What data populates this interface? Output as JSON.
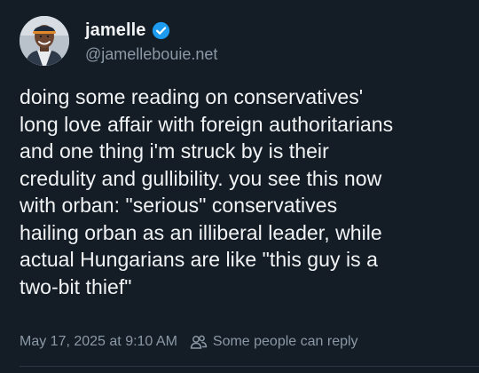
{
  "author": {
    "display_name": "jamelle",
    "handle": "@jamellebouie.net",
    "avatar_icon": "avatar-photo",
    "verified_icon": "verified-badge-icon",
    "verified_color": "#1d9bf0"
  },
  "post": {
    "text": "doing some reading on conservatives'\nlong love affair with foreign authoritarians\nand one thing i'm struck by is their\ncredulity and gullibility. you see this now\nwith orban: \"serious\" conservatives\nhailing orban as an illiberal leader, while\nactual Hungarians are like \"this guy is a\ntwo-bit thief\""
  },
  "meta": {
    "timestamp": "May 17, 2025 at 9:10 AM",
    "reply_setting": "Some people can reply",
    "reply_icon": "people-icon"
  },
  "colors": {
    "background": "#141d26",
    "text_primary": "#f1f3f5",
    "text_secondary": "#8b98a5"
  }
}
